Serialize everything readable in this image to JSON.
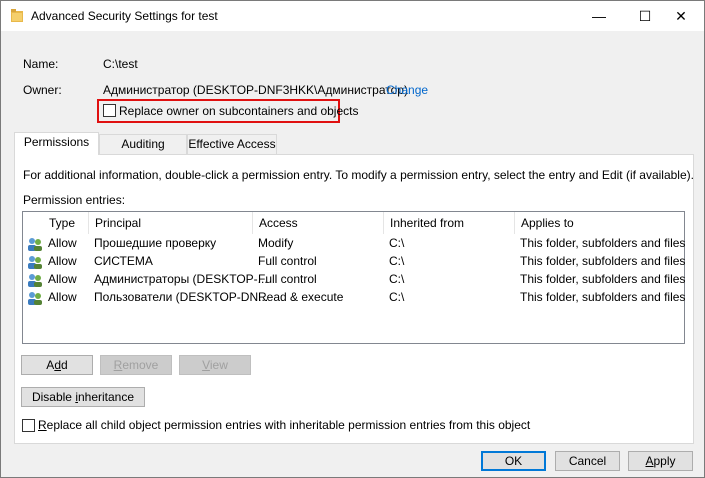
{
  "window": {
    "title": "Advanced Security Settings for test",
    "minimize_glyph": "—",
    "maximize_glyph": "☐",
    "close_glyph": "✕"
  },
  "info": {
    "name_label": "Name:",
    "name_value": "C:\\test",
    "owner_label": "Owner:",
    "owner_value": "Администратор (DESKTOP-DNF3HKK\\Администратор)",
    "change_link": "Change",
    "replace_owner_label": "Replace owner on subcontainers and objects"
  },
  "tabs": [
    {
      "label": "Permissions",
      "active": true
    },
    {
      "label": "Auditing",
      "active": false
    },
    {
      "label": "Effective Access",
      "active": false
    }
  ],
  "permissions": {
    "instructions": "For additional information, double-click a permission entry. To modify a permission entry, select the entry and Edit (if available).",
    "entries_label": "Permission entries:",
    "columns": [
      "Type",
      "Principal",
      "Access",
      "Inherited from",
      "Applies to"
    ],
    "rows": [
      {
        "type": "Allow",
        "principal": "Прошедшие проверку",
        "access": "Modify",
        "inherited": "C:\\",
        "applies": "This folder, subfolders and files"
      },
      {
        "type": "Allow",
        "principal": "СИСТЕМА",
        "access": "Full control",
        "inherited": "C:\\",
        "applies": "This folder, subfolders and files"
      },
      {
        "type": "Allow",
        "principal": "Администраторы (DESKTOP-...",
        "access": "Full control",
        "inherited": "C:\\",
        "applies": "This folder, subfolders and files"
      },
      {
        "type": "Allow",
        "principal": "Пользователи (DESKTOP-DN...",
        "access": "Read & execute",
        "inherited": "C:\\",
        "applies": "This folder, subfolders and files"
      }
    ]
  },
  "buttons": {
    "add": {
      "pre": "A",
      "key": "d",
      "post": "d"
    },
    "remove": {
      "pre": "",
      "key": "R",
      "post": "emove"
    },
    "view": {
      "pre": "",
      "key": "V",
      "post": "iew"
    },
    "disable_inheritance": {
      "pre": "Disable ",
      "key": "i",
      "post": "nheritance"
    },
    "ok": "OK",
    "cancel": "Cancel",
    "apply": {
      "pre": "",
      "key": "A",
      "post": "pply"
    }
  },
  "replace_child": {
    "pre": "",
    "key": "R",
    "post": "eplace all child object permission entries with inheritable permission entries from this object"
  },
  "colors": {
    "link": "#0066cc",
    "highlight_border": "#e01010",
    "default_button_border": "#0078d7"
  }
}
